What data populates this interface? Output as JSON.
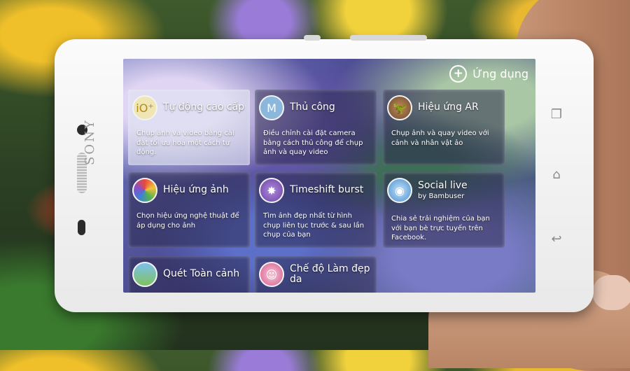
{
  "device": {
    "brand": "SONY"
  },
  "header": {
    "add_label": "Ứng dụng",
    "add_icon": "plus-circle-icon"
  },
  "tiles": [
    {
      "title": "Tự động cao cấp",
      "subtitle": "",
      "description": "Chụp ảnh và video bằng cài đặt tối ưu hoá một cách tự động.",
      "icon": "superior-auto-icon",
      "icon_glyph": "iO⁺",
      "selected": true
    },
    {
      "title": "Thủ công",
      "subtitle": "",
      "description": "Điều chỉnh cài đặt camera bằng cách thủ công để chụp ảnh và quay video",
      "icon": "manual-m-icon",
      "icon_glyph": "M",
      "selected": false
    },
    {
      "title": "Hiệu ứng AR",
      "subtitle": "",
      "description": "Chụp ảnh và quay video với cảnh và nhân vật ảo",
      "icon": "dinosaur-ar-icon",
      "icon_glyph": "🦖",
      "selected": false
    },
    {
      "title": "Hiệu ứng ảnh",
      "subtitle": "",
      "description": "Chọn hiệu ứng nghệ thuật để áp dụng cho ảnh",
      "icon": "palette-icon",
      "icon_glyph": "",
      "selected": false
    },
    {
      "title": "Timeshift burst",
      "subtitle": "",
      "description": "Tìm ảnh đẹp nhất từ hình chụp liên tục trước & sau lần chụp của bạn",
      "icon": "timeshift-burst-icon",
      "icon_glyph": "✸",
      "selected": false
    },
    {
      "title": "Social live",
      "subtitle": "by Bambuser",
      "description": "Chia sẻ trải nghiệm của bạn với bạn bè trực tuyến trên Facebook.",
      "icon": "broadcast-icon",
      "icon_glyph": "◉",
      "selected": false
    },
    {
      "title": "Quét Toàn cảnh",
      "subtitle": "",
      "description": "",
      "icon": "panorama-icon",
      "icon_glyph": "",
      "selected": false
    },
    {
      "title": "Chế độ Làm đẹp da",
      "subtitle": "",
      "description": "",
      "icon": "beauty-face-icon",
      "icon_glyph": "☺",
      "selected": false
    }
  ],
  "softkeys": [
    {
      "name": "recent-apps",
      "glyph": "❐"
    },
    {
      "name": "home",
      "glyph": "⌂"
    },
    {
      "name": "back",
      "glyph": "↩"
    }
  ]
}
